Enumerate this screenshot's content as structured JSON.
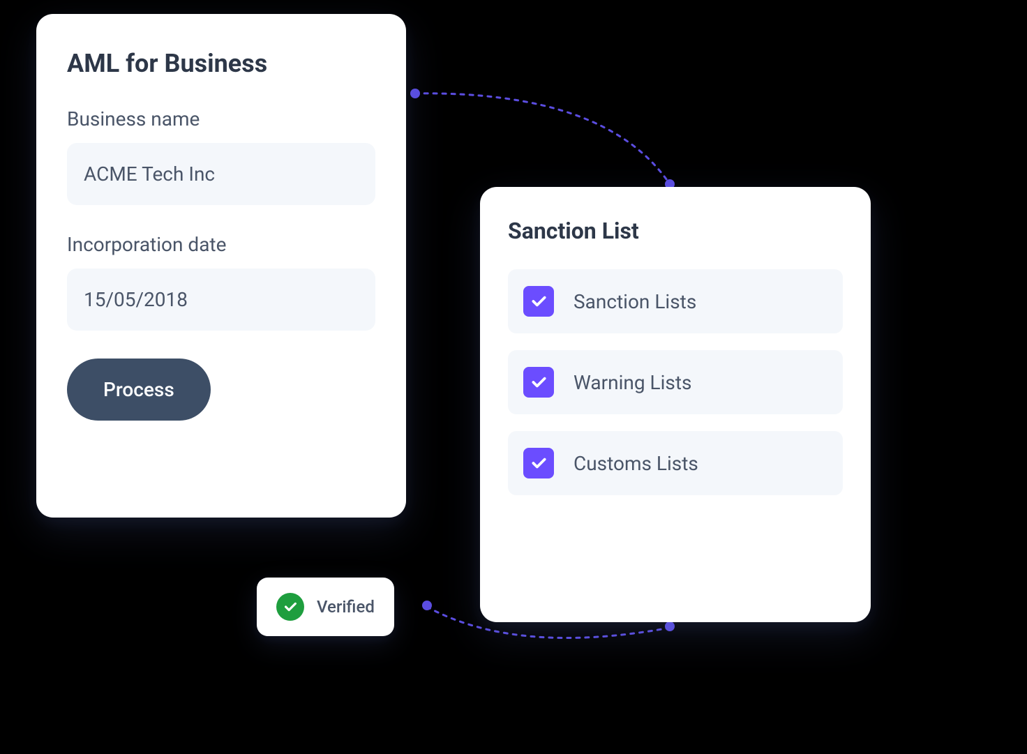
{
  "aml_form": {
    "title": "AML for Business",
    "business_name_label": "Business name",
    "business_name_value": "ACME Tech Inc",
    "incorporation_date_label": "Incorporation date",
    "incorporation_date_value": "15/05/2018",
    "process_button_label": "Process"
  },
  "sanction_list": {
    "title": "Sanction List",
    "items": [
      {
        "label": "Sanction Lists",
        "checked": true
      },
      {
        "label": "Warning Lists",
        "checked": true
      },
      {
        "label": "Customs Lists",
        "checked": true
      }
    ]
  },
  "verified_badge": {
    "label": "Verified"
  },
  "colors": {
    "checkbox_bg": "#6b4dff",
    "verified_bg": "#1e9e3e",
    "process_button_bg": "#3d4e66",
    "connector": "#5b4de0"
  }
}
